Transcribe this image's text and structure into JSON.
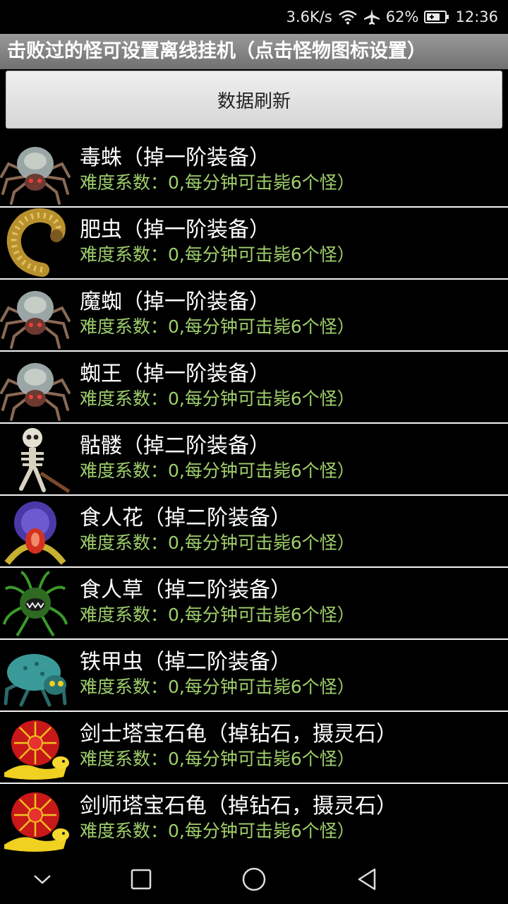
{
  "status_bar": {
    "speed": "3.6K/s",
    "battery": "62%",
    "time": "12:36",
    "icons": [
      "wifi-icon",
      "airplane-icon",
      "battery-icon"
    ]
  },
  "header": {
    "title": "击败过的怪可设置离线挂机（点击怪物图标设置）"
  },
  "refresh_button": {
    "label": "数据刷新"
  },
  "monsters": [
    {
      "name": "毒蛛（掉一阶装备）",
      "info": "难度系数：0,每分钟可击毙6个怪）",
      "icon": "spider"
    },
    {
      "name": "肥虫（掉一阶装备）",
      "info": "难度系数：0,每分钟可击毙6个怪）",
      "icon": "worm"
    },
    {
      "name": "魔蜘（掉一阶装备）",
      "info": "难度系数：0,每分钟可击毙6个怪）",
      "icon": "spider"
    },
    {
      "name": "蜘王（掉一阶装备）",
      "info": "难度系数：0,每分钟可击毙6个怪）",
      "icon": "spider"
    },
    {
      "name": "骷髅（掉二阶装备）",
      "info": "难度系数：0,每分钟可击毙6个怪）",
      "icon": "skeleton"
    },
    {
      "name": "食人花（掉二阶装备）",
      "info": "难度系数：0,每分钟可击毙6个怪）",
      "icon": "flower"
    },
    {
      "name": "食人草（掉二阶装备）",
      "info": "难度系数：0,每分钟可击毙6个怪）",
      "icon": "grass"
    },
    {
      "name": "铁甲虫（掉二阶装备）",
      "info": "难度系数：0,每分钟可击毙6个怪）",
      "icon": "beetle"
    },
    {
      "name": "剑士塔宝石龟（掉钻石，摄灵石）",
      "info": "难度系数：0,每分钟可击毙6个怪）",
      "icon": "turtle"
    },
    {
      "name": "剑师塔宝石龟（掉钻石，摄灵石）",
      "info": "难度系数：0,每分钟可击毙6个怪）",
      "icon": "turtle"
    }
  ],
  "nav_bar": {
    "buttons": [
      "chevron-down-icon",
      "square-recents-icon",
      "circle-home-icon",
      "triangle-back-icon"
    ]
  }
}
